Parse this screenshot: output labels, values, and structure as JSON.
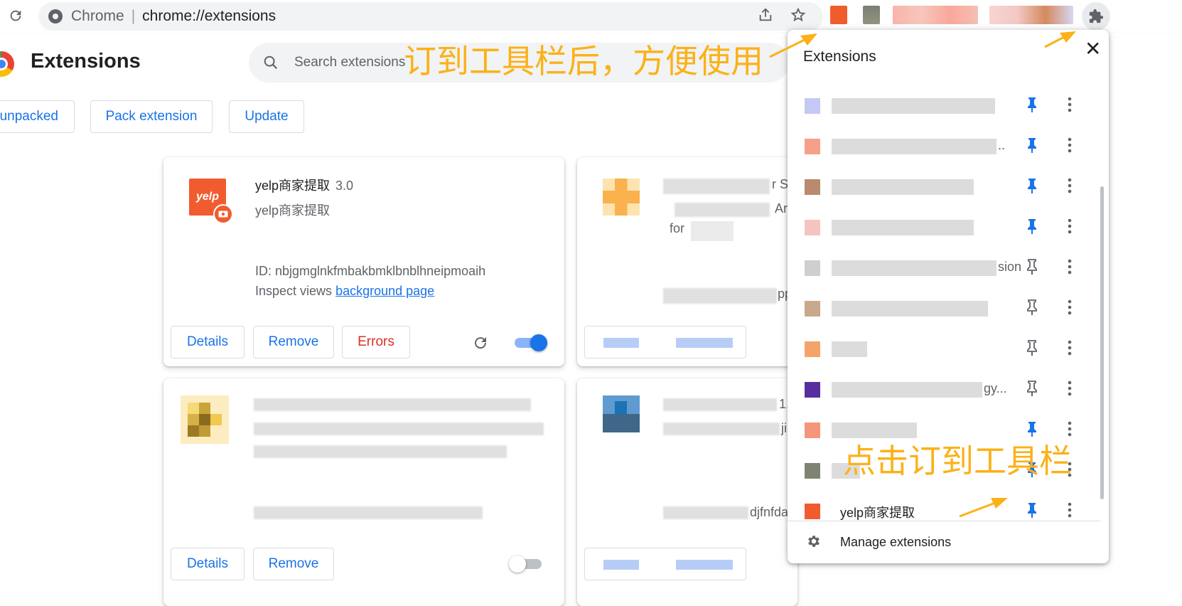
{
  "browser": {
    "scheme_label": "Chrome",
    "url": "chrome://extensions"
  },
  "header": {
    "title": "Extensions",
    "search_placeholder": "Search extensions",
    "buttons": {
      "load_unpacked": "unpacked",
      "pack_extension": "Pack extension",
      "update": "Update"
    }
  },
  "cards": {
    "yelp": {
      "name": "yelp商家提取",
      "version": "3.0",
      "description": "yelp商家提取",
      "id_line": "ID: nbjgmglnkfmbakbmklbnblhneipmoaih",
      "inspect_prefix": "Inspect views",
      "inspect_link": "background page",
      "details": "Details",
      "remove": "Remove",
      "errors": "Errors",
      "enabled": true,
      "logo_text": "yelp"
    },
    "card2": {
      "frag1": "r S",
      "frag2": "Ar",
      "frag3": "for",
      "frag4": "pp"
    },
    "card3": {
      "details": "Details",
      "remove": "Remove",
      "enabled": false
    },
    "card4": {
      "frag1": "1.",
      "frag2": "ji",
      "frag3": "djfnfda"
    }
  },
  "popup": {
    "title": "Extensions",
    "close": "✕",
    "items": [
      {
        "label": "",
        "pinned": true,
        "color": "#c5c8f5"
      },
      {
        "label": "..",
        "pinned": true,
        "color": "#f7a089"
      },
      {
        "label": "",
        "pinned": true,
        "color": "#b98a6e"
      },
      {
        "label": "",
        "pinned": true,
        "color": "#f5c4c0"
      },
      {
        "label": "sion",
        "pinned": false,
        "color": "#cfcfcf"
      },
      {
        "label": "",
        "pinned": false,
        "color": "#c9a98b"
      },
      {
        "label": "",
        "pinned": false,
        "color": "#f4a46a"
      },
      {
        "label": "gy...",
        "pinned": false,
        "color": "#5a2d9e"
      },
      {
        "label": "",
        "pinned": true,
        "color": "#f7957a"
      },
      {
        "label": "",
        "pinned": true,
        "color": "#7d8473"
      },
      {
        "label": "yelp商家提取",
        "pinned": true,
        "color": "#f15c2f"
      }
    ],
    "manage": "Manage extensions"
  },
  "annotations": {
    "top": "订到工具栏后，方便使用",
    "bottom": "点击订到工具栏"
  },
  "colors": {
    "accent": "#1a73e8",
    "annotation": "#fbb117",
    "error": "#d93025"
  }
}
